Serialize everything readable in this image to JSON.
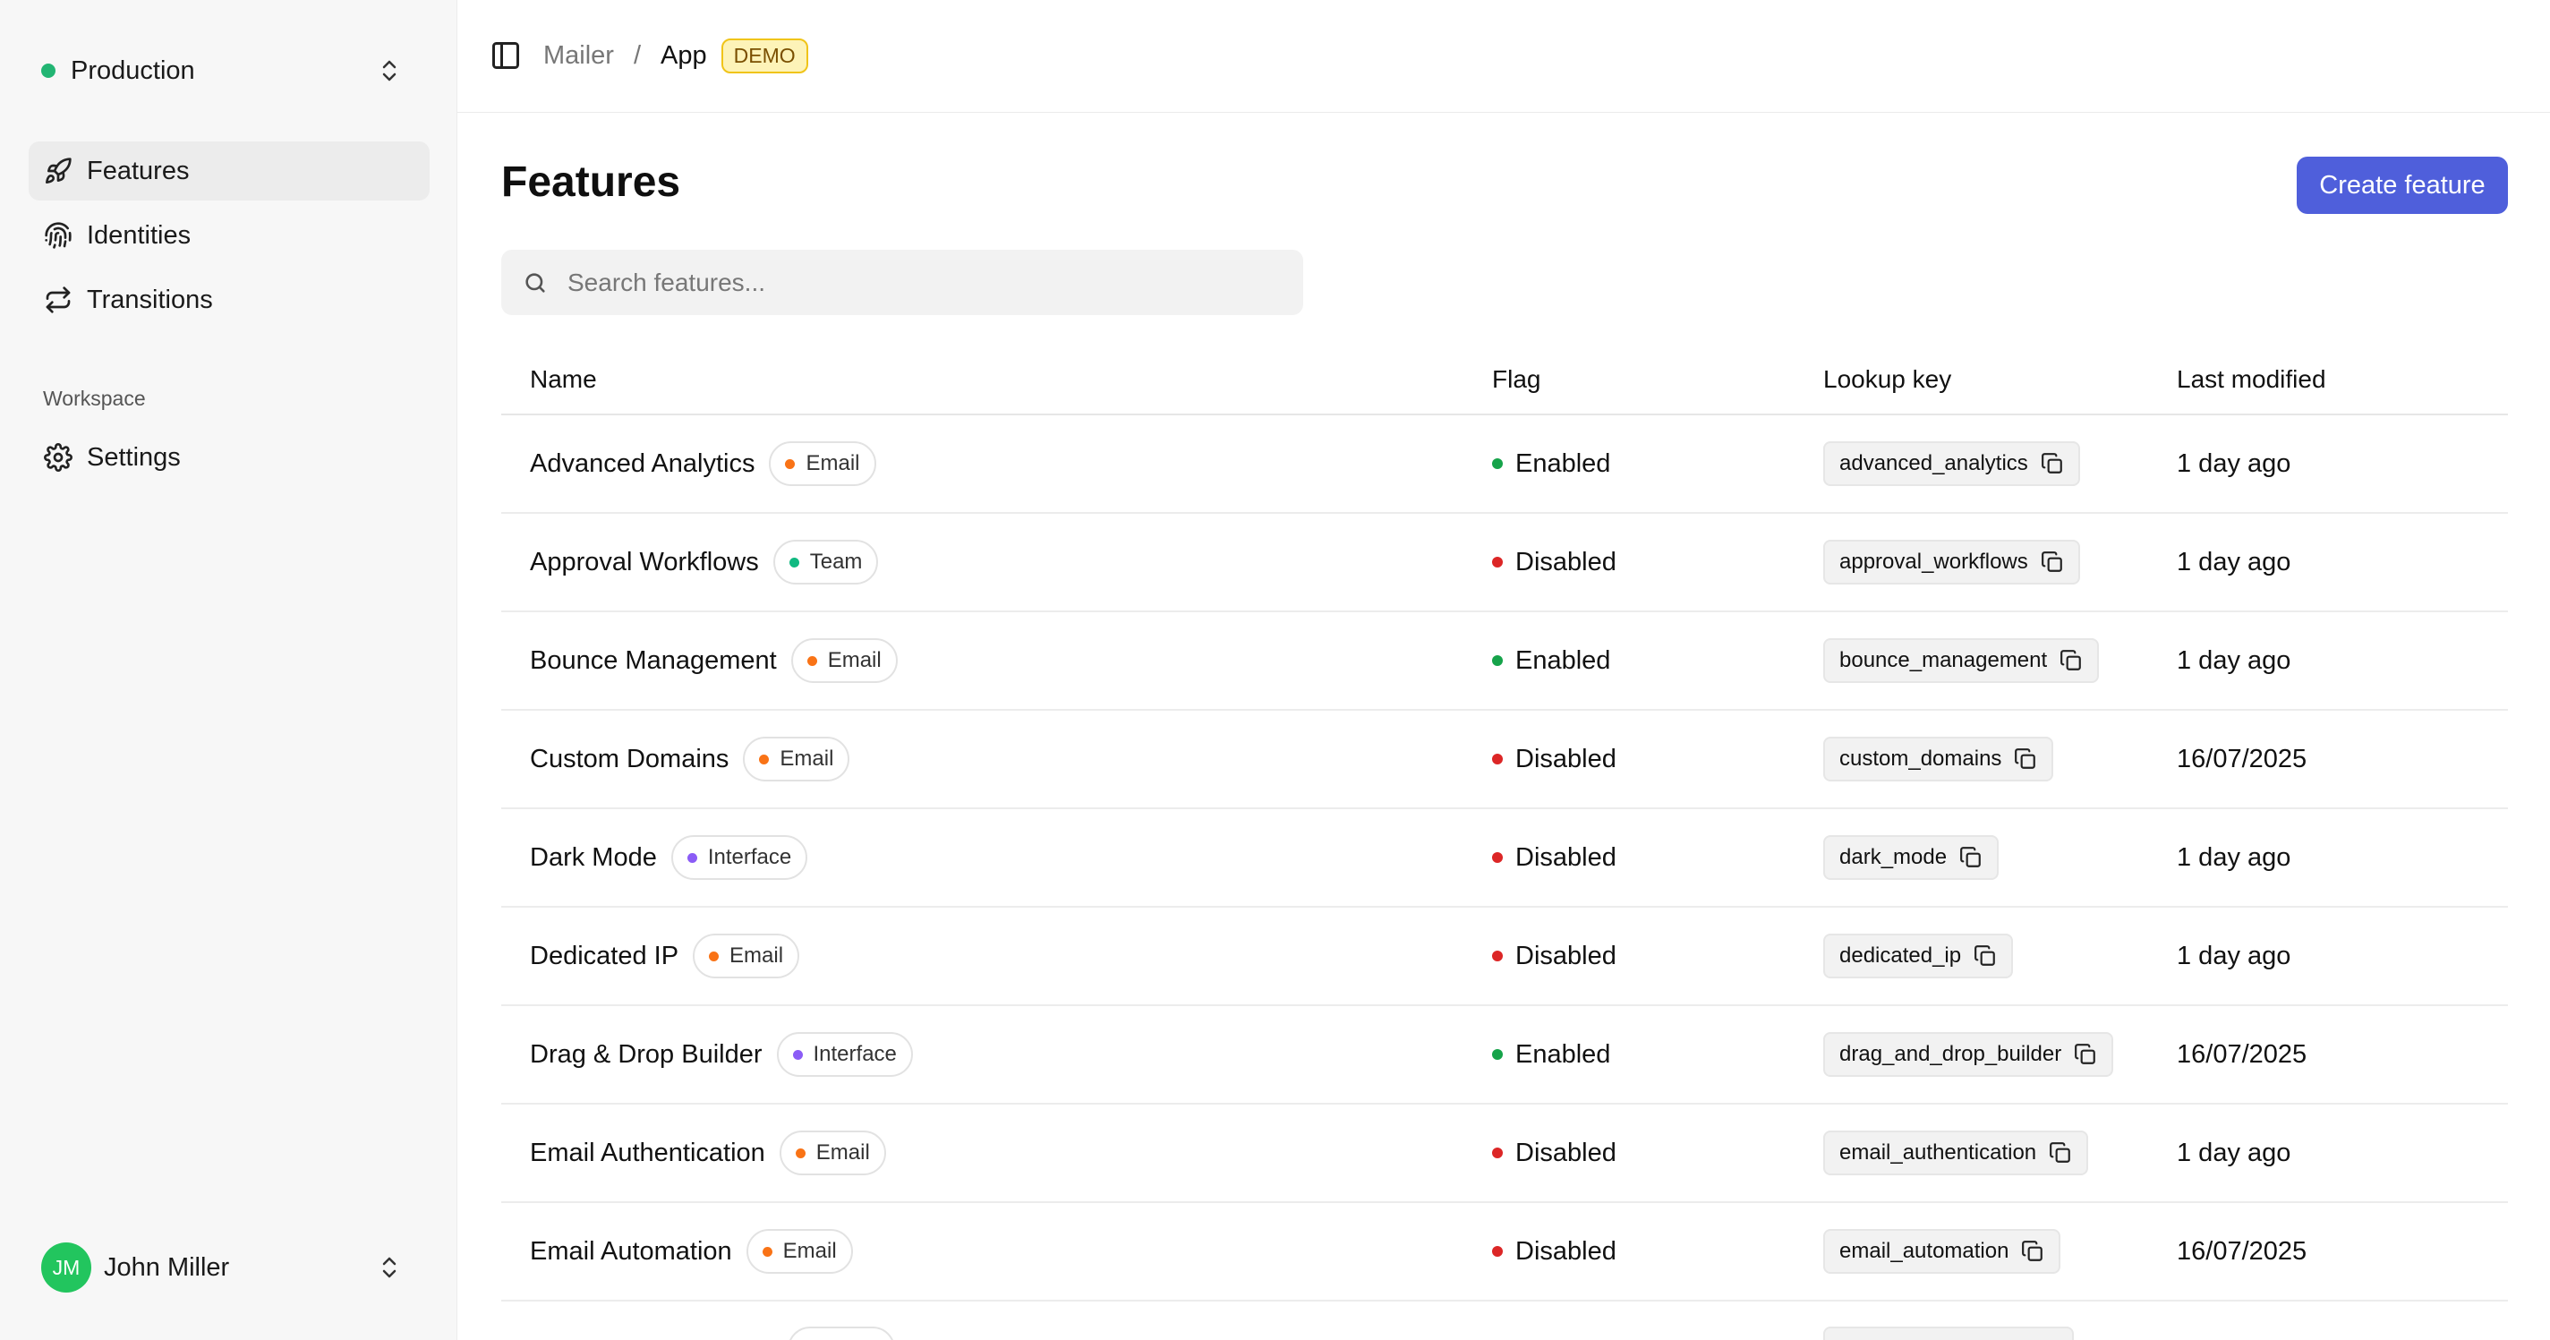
{
  "sidebar": {
    "environment": "Production",
    "nav": [
      {
        "label": "Features",
        "icon": "rocket-icon",
        "active": true
      },
      {
        "label": "Identities",
        "icon": "fingerprint-icon",
        "active": false
      },
      {
        "label": "Transitions",
        "icon": "repeat-icon",
        "active": false
      }
    ],
    "workspace_title": "Workspace",
    "settings_label": "Settings",
    "user": {
      "initials": "JM",
      "name": "John Miller"
    }
  },
  "header": {
    "breadcrumb_root": "Mailer",
    "breadcrumb_separator": "/",
    "breadcrumb_current": "App",
    "badge": "DEMO"
  },
  "main": {
    "title": "Features",
    "create_button": "Create feature",
    "search_placeholder": "Search features..."
  },
  "table": {
    "columns": [
      "Name",
      "Flag",
      "Lookup key",
      "Last modified"
    ],
    "rows": [
      {
        "name": "Advanced Analytics",
        "tag": "Email",
        "flag": "Enabled",
        "key": "advanced_analytics",
        "modified": "1 day ago"
      },
      {
        "name": "Approval Workflows",
        "tag": "Team",
        "flag": "Disabled",
        "key": "approval_workflows",
        "modified": "1 day ago"
      },
      {
        "name": "Bounce Management",
        "tag": "Email",
        "flag": "Enabled",
        "key": "bounce_management",
        "modified": "1 day ago"
      },
      {
        "name": "Custom Domains",
        "tag": "Email",
        "flag": "Disabled",
        "key": "custom_domains",
        "modified": "16/07/2025"
      },
      {
        "name": "Dark Mode",
        "tag": "Interface",
        "flag": "Disabled",
        "key": "dark_mode",
        "modified": "1 day ago"
      },
      {
        "name": "Dedicated IP",
        "tag": "Email",
        "flag": "Disabled",
        "key": "dedicated_ip",
        "modified": "1 day ago"
      },
      {
        "name": "Drag & Drop Builder",
        "tag": "Interface",
        "flag": "Enabled",
        "key": "drag_and_drop_builder",
        "modified": "16/07/2025"
      },
      {
        "name": "Email Authentication",
        "tag": "Email",
        "flag": "Disabled",
        "key": "email_authentication",
        "modified": "1 day ago"
      },
      {
        "name": "Email Automation",
        "tag": "Email",
        "flag": "Disabled",
        "key": "email_automation",
        "modified": "16/07/2025"
      }
    ]
  },
  "colors": {
    "accent": "#4f5fdb",
    "enabled": "#16a34a",
    "disabled": "#dc2626",
    "tag_email": "#f97316",
    "tag_team": "#10b981",
    "tag_interface": "#8b5cf6",
    "env_dot": "#22b573",
    "avatar": "#22c55e"
  }
}
